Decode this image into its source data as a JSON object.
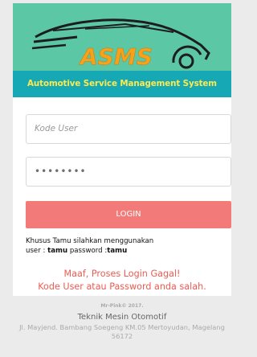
{
  "header": {
    "logo_text": "ASMS",
    "subtitle": "Automotive Service Management System"
  },
  "form": {
    "user_placeholder": "Kode User",
    "password_value": "••••••••",
    "login_label": "LOGIN"
  },
  "guest_note": {
    "line1": "Khusus Tamu silahkan menggunakan",
    "user_prefix": "user : ",
    "user_value": "tamu",
    "password_prefix": " password :",
    "password_value": "tamu"
  },
  "error": {
    "line1": "Maaf, Proses Login Gagal!",
    "line2": "Kode User atau Password anda salah."
  },
  "footer": {
    "copyright": "Mr-Pink© 2017.",
    "institution": "Teknik Mesin Otomotif",
    "address_line1": "Jl. Mayjend. Bambang Soegeng KM.05 Mertoyudan, Magelang",
    "address_line2": "56172"
  },
  "colors": {
    "header_bg": "#5cc7a5",
    "subtitle_band": "#17a8b6",
    "subtitle_text": "#ffe94a",
    "logo_text": "#f7a21b",
    "login_button": "#f27b7a",
    "error_text": "#ea5c52",
    "page_bg": "#ebebeb"
  }
}
